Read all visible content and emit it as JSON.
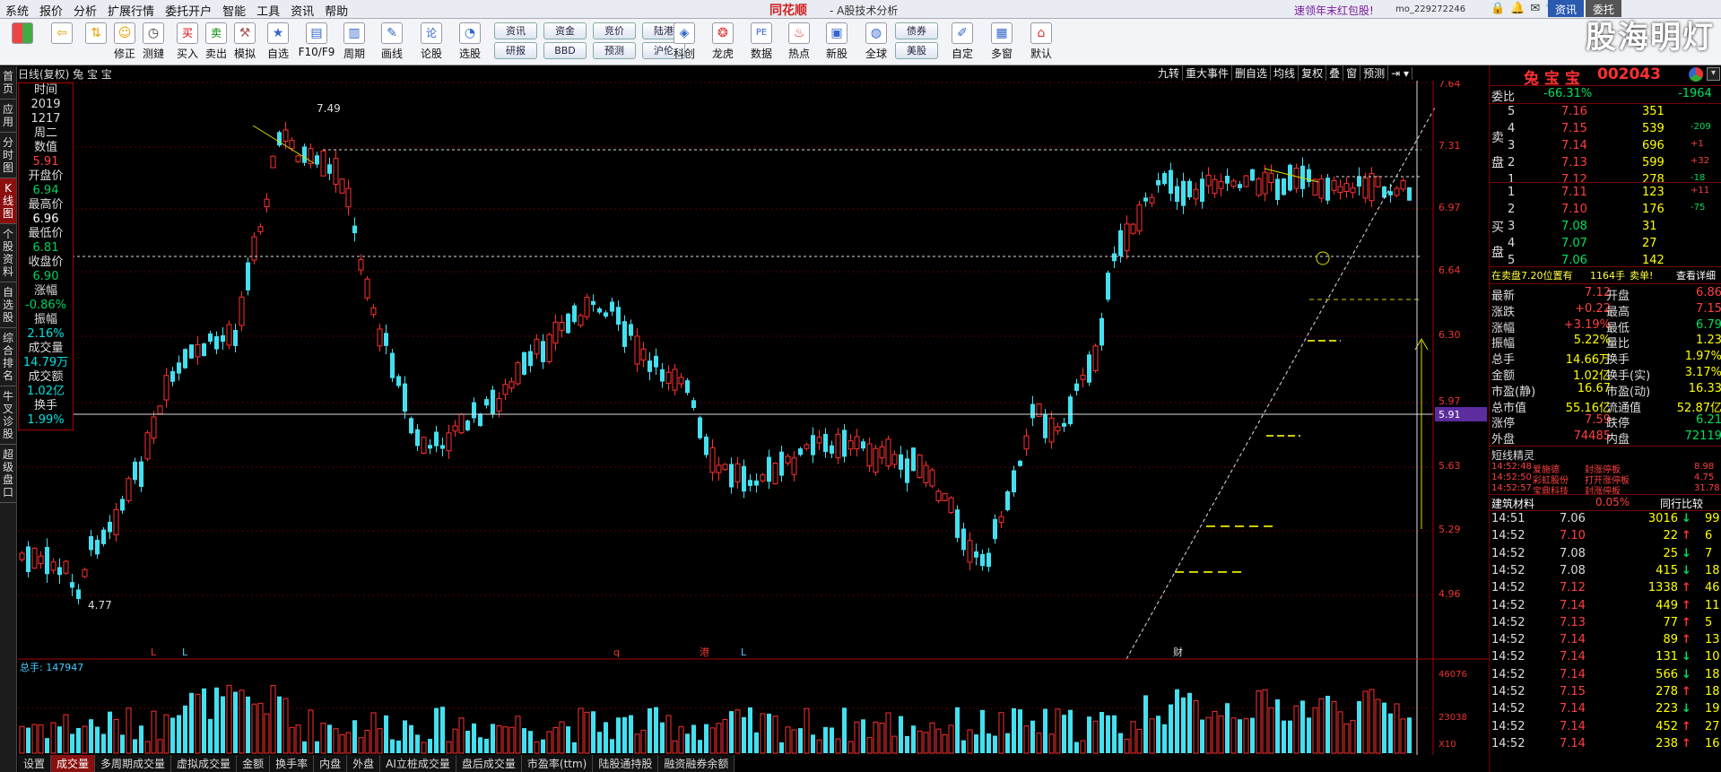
{
  "menu": {
    "items": [
      "系统",
      "报价",
      "分析",
      "扩展行情",
      "委托开户",
      "智能",
      "工具",
      "资讯",
      "帮助"
    ],
    "brand": "同花顺",
    "subtitle": "- A股技术分析",
    "promo": "速领年末红包股!",
    "user_id": "mo_229272246",
    "tab_quote": "资讯",
    "tab_entrust": "委托"
  },
  "toolbar": {
    "buttons": [
      "修正",
      "测鏈",
      "买入",
      "卖出",
      "模拟",
      "自选",
      "F10/F9",
      "周期",
      "画线",
      "论股",
      "选股"
    ],
    "mini": [
      [
        "资讯",
        "资金",
        "竞价",
        "陆港"
      ],
      [
        "研报",
        "BBD",
        "预测",
        "沪伦"
      ]
    ],
    "buttons2": [
      "科创",
      "龙虎",
      "数据",
      "热点",
      "新股",
      "全球"
    ],
    "mini2": [
      "债券",
      "美股"
    ],
    "buttons3": [
      "自定",
      "多窗",
      "默认"
    ]
  },
  "watermark": "股海明灯",
  "left_tabs": [
    "首页",
    "应用",
    "分时图",
    "K线图",
    "个股资料",
    "自选股",
    "综合排名",
    "牛叉诊股",
    "超级盘口"
  ],
  "chart": {
    "title": "日线(复权) 兔 宝 宝",
    "tabs": [
      "九转",
      "重大事件",
      "删自选",
      "均线",
      "复权",
      "叠",
      "窗",
      "预测"
    ],
    "high_label": "7.49",
    "low_label": "4.77",
    "y_ticks": [
      "7.64",
      "7.31",
      "6.97",
      "6.64",
      "6.30",
      "5.97",
      "5.63",
      "5.29",
      "4.96"
    ],
    "cursor_price": "5.91",
    "markers": [
      "L",
      "L",
      "q",
      "港",
      "L",
      "财"
    ]
  },
  "info": {
    "time_label": "时间",
    "year": "2019",
    "date": "1217",
    "weekday": "周二",
    "value_label": "数值",
    "value": "5.91",
    "open_label": "开盘价",
    "open": "6.94",
    "high_label": "最高价",
    "high": "6.96",
    "low_label": "最低价",
    "low": "6.81",
    "close_label": "收盘价",
    "close": "6.90",
    "chg_label": "涨幅",
    "chg": "-0.86%",
    "amp_label": "振幅",
    "amp": "2.16%",
    "vol_label": "成交量",
    "vol": "14.79万",
    "amt_label": "成交额",
    "amt": "1.02亿",
    "turn_label": "换手",
    "turn": "1.99%"
  },
  "volume": {
    "label": "总手: 147947",
    "ticks": [
      "46076",
      "23038",
      "X10"
    ]
  },
  "bottom_tabs": [
    "设置",
    "成交量",
    "多周期成交量",
    "虚拟成交量",
    "金额",
    "换手率",
    "内盘",
    "外盘",
    "AI立桩成交量",
    "盘后成交量",
    "市盈率(ttm)",
    "陆股通持股",
    "融资融券余额"
  ],
  "quote": {
    "name": "兔 宝 宝",
    "code": "002043",
    "weibi_label": "委比",
    "weibi": "-66.31%",
    "weicha": "-1964",
    "sell_label": [
      "卖",
      "盘"
    ],
    "buy_label": [
      "买",
      "盘"
    ],
    "asks": [
      [
        "5",
        "7.16",
        "351",
        ""
      ],
      [
        "4",
        "7.15",
        "539",
        "-209"
      ],
      [
        "3",
        "7.14",
        "696",
        "+1"
      ],
      [
        "2",
        "7.13",
        "599",
        "+32"
      ],
      [
        "1",
        "7.12",
        "278",
        "-18"
      ]
    ],
    "bids": [
      [
        "1",
        "7.11",
        "123",
        "+11"
      ],
      [
        "2",
        "7.10",
        "176",
        "-75"
      ],
      [
        "3",
        "7.08",
        "31",
        ""
      ],
      [
        "4",
        "7.07",
        "27",
        ""
      ],
      [
        "5",
        "7.06",
        "142",
        ""
      ]
    ],
    "notice": "在卖盘7.20位置有",
    "notice_vol": "1164手",
    "notice_tag": "卖单!",
    "notice_link": "查看详细",
    "stats": [
      [
        "最新",
        "7.12",
        "开盘",
        "6.86"
      ],
      [
        "涨跌",
        "+0.22",
        "最高",
        "7.15"
      ],
      [
        "涨幅",
        "+3.19%",
        "最低",
        "6.79"
      ],
      [
        "振幅",
        "5.22%",
        "量比",
        "1.23"
      ],
      [
        "总手",
        "14.66万",
        "换手",
        "1.97%"
      ],
      [
        "金额",
        "1.02亿",
        "换手(实)",
        "3.17%"
      ],
      [
        "市盈(静)",
        "16.67",
        "市盈(动)",
        "16.33"
      ],
      [
        "总市值",
        "55.16亿",
        "流通值",
        "52.87亿"
      ],
      [
        "涨停",
        "7.59",
        "跌停",
        "6.21"
      ],
      [
        "外盘",
        "74485",
        "内盘",
        "72119"
      ]
    ],
    "sprite_title": "短线精灵",
    "sprites": [
      [
        "14:52:48",
        "爱施德",
        "封涨停板",
        "8.98"
      ],
      [
        "14:52:50",
        "彩虹股份",
        "打开涨停板",
        "4.75"
      ],
      [
        "14:52:57",
        "宝鼎科技",
        "封涨停板",
        "31.78"
      ]
    ],
    "industry": "建筑材料",
    "industry_chg": "0.05%",
    "industry_link": "同行比较",
    "ticks": [
      [
        "14:51",
        "7.06",
        "3016",
        "↓",
        "99"
      ],
      [
        "14:52",
        "7.10",
        "22",
        "↑",
        "6"
      ],
      [
        "14:52",
        "7.08",
        "25",
        "↓",
        "7"
      ],
      [
        "14:52",
        "7.08",
        "415",
        "↓",
        "18"
      ],
      [
        "14:52",
        "7.12",
        "1338",
        "↑",
        "46"
      ],
      [
        "14:52",
        "7.14",
        "449",
        "↑",
        "11"
      ],
      [
        "14:52",
        "7.13",
        "77",
        "↑",
        "5"
      ],
      [
        "14:52",
        "7.14",
        "89",
        "↑",
        "13"
      ],
      [
        "14:52",
        "7.14",
        "131",
        "↓",
        "10"
      ],
      [
        "14:52",
        "7.14",
        "566",
        "↓",
        "18"
      ],
      [
        "14:52",
        "7.15",
        "278",
        "↑",
        "18"
      ],
      [
        "14:52",
        "7.14",
        "223",
        "↓",
        "19"
      ],
      [
        "14:52",
        "7.14",
        "452",
        "↑",
        "27"
      ],
      [
        "14:52",
        "7.14",
        "238",
        "↑",
        "16"
      ]
    ]
  }
}
